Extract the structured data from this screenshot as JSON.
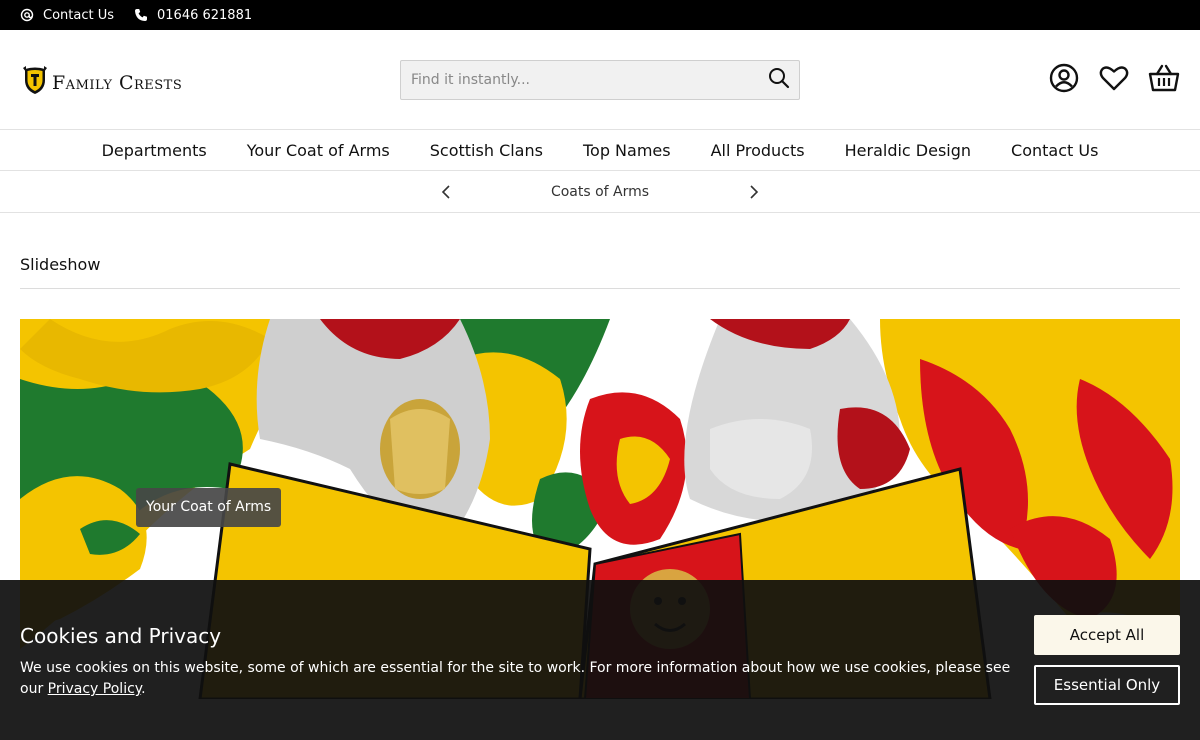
{
  "topbar": {
    "contact_label": "Contact Us",
    "phone": "01646 621881",
    "contact_icon": "at-icon",
    "phone_icon": "phone-icon"
  },
  "header": {
    "logo_text": "Family Crests",
    "search_placeholder": "Find it instantly...",
    "icons": [
      "account-icon",
      "heart-icon",
      "basket-icon"
    ]
  },
  "nav": {
    "items": [
      "Departments",
      "Your Coat of Arms",
      "Scottish Clans",
      "Top Names",
      "All Products",
      "Heraldic Design",
      "Contact Us"
    ]
  },
  "category_bar": {
    "current": "Coats of Arms"
  },
  "section": {
    "title": "Slideshow"
  },
  "hero": {
    "badge": "Your Coat of Arms"
  },
  "cookie": {
    "title": "Cookies and Privacy",
    "text_before": "We use cookies on this website, some of which are essential for the site to work. For more information about how we use cookies, please see our ",
    "link": "Privacy Policy",
    "text_after": ".",
    "accept_label": "Accept All",
    "essential_label": "Essential Only"
  },
  "colors": {
    "gold": "#f4c400",
    "green": "#1f7a2e",
    "red": "#d7141a",
    "silver": "#cfcfcf"
  }
}
